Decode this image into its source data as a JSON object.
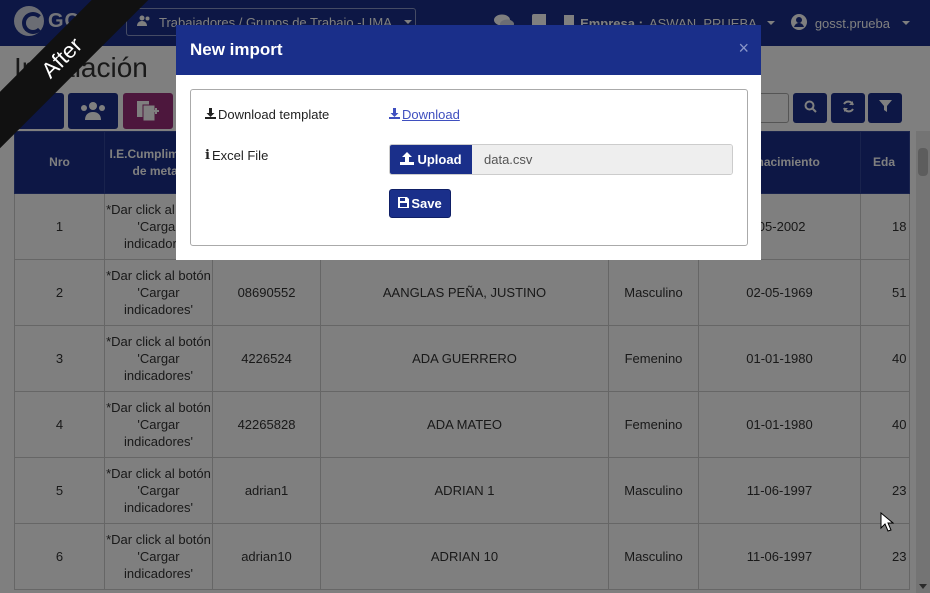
{
  "navbar": {
    "brand": "GO",
    "workers_dropdown": "Trabajadores / Grupos de Trabajo -LIMA",
    "company_label": "Empresa :",
    "company_value": "ASWAN_PRUEBA",
    "user": "gosst.prueba"
  },
  "page": {
    "title": "Instalación"
  },
  "table": {
    "headers": [
      "Nro",
      "I.E.Cumplimiento de metas",
      "",
      "",
      "",
      "de nacimiento",
      "Eda"
    ],
    "rows": [
      [
        "1",
        "*Dar click al botón 'Cargar indicadores'",
        "",
        "",
        "",
        "-05-2002",
        "18"
      ],
      [
        "2",
        "*Dar click al botón 'Cargar indicadores'",
        "08690552",
        "AANGLAS PEÑA, JUSTINO",
        "Masculino",
        "02-05-1969",
        "51"
      ],
      [
        "3",
        "*Dar click al botón 'Cargar indicadores'",
        "4226524",
        "ADA GUERRERO",
        "Femenino",
        "01-01-1980",
        "40"
      ],
      [
        "4",
        "*Dar click al botón 'Cargar indicadores'",
        "42265828",
        "ADA MATEO",
        "Femenino",
        "01-01-1980",
        "40"
      ],
      [
        "5",
        "*Dar click al botón 'Cargar indicadores'",
        "adrian1",
        "ADRIAN 1",
        "Masculino",
        "11-06-1997",
        "23"
      ],
      [
        "6",
        "*Dar click al botón 'Cargar indicadores'",
        "adrian10",
        "ADRIAN 10",
        "Masculino",
        "11-06-1997",
        "23"
      ]
    ]
  },
  "modal": {
    "title": "New import",
    "close": "×",
    "template_label": "Download template",
    "download_link": "Download",
    "file_label": "Excel File",
    "upload_button": "Upload",
    "file_name": "data.csv",
    "save_button": "Save"
  },
  "ribbon": "After",
  "colors": {
    "primary": "#1a2f8a",
    "link": "#3f4fbf"
  }
}
